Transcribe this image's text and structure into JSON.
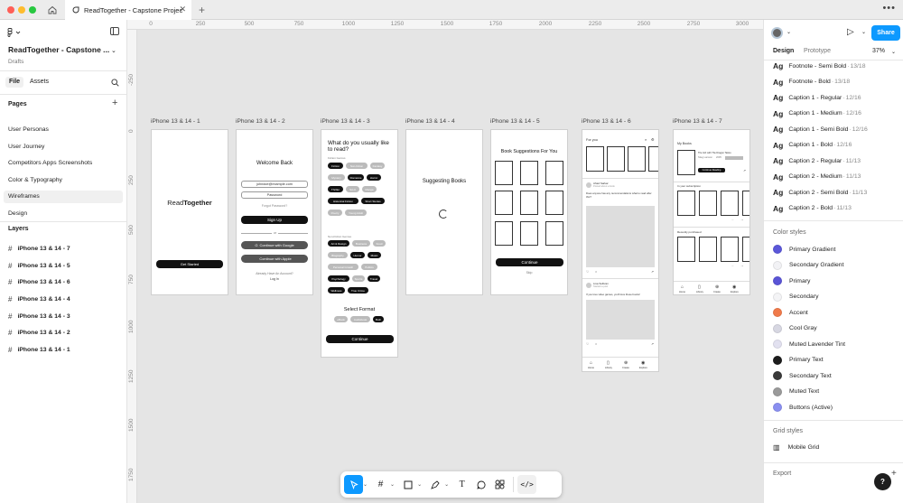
{
  "window": {
    "tab_title": "ReadTogether - Capstone Project",
    "tab_title_visible": "ReadTogether - Capstone Projec"
  },
  "left_panel": {
    "project_name": "ReadTogether - Capstone ...",
    "location": "Drafts",
    "tabs": [
      {
        "label": "File"
      },
      {
        "label": "Assets"
      }
    ],
    "pages_heading": "Pages",
    "pages": [
      {
        "label": "User Personas"
      },
      {
        "label": "User Journey"
      },
      {
        "label": "Competitors Apps Screenshots"
      },
      {
        "label": "Color & Typography"
      },
      {
        "label": "Wireframes"
      },
      {
        "label": "Design"
      }
    ],
    "selected_page": "Wireframes",
    "layers_heading": "Layers",
    "layers": [
      {
        "label": "iPhone 13 & 14 - 7"
      },
      {
        "label": "iPhone 13 & 14 - 5"
      },
      {
        "label": "iPhone 13 & 14 - 6"
      },
      {
        "label": "iPhone 13 & 14 - 4"
      },
      {
        "label": "iPhone 13 & 14 - 3"
      },
      {
        "label": "iPhone 13 & 14 - 2"
      },
      {
        "label": "iPhone 13 & 14 - 1"
      }
    ]
  },
  "rulers": {
    "top": [
      "0",
      "250",
      "500",
      "750",
      "1000",
      "1250",
      "1500",
      "1750",
      "2000",
      "2250",
      "2500",
      "2750",
      "3000"
    ],
    "left": [
      "-250",
      "0",
      "250",
      "500",
      "750",
      "1000",
      "1250",
      "1500",
      "1750"
    ]
  },
  "canvas": {
    "frame_labels": [
      "iPhone 13 & 14 - 1",
      "iPhone 13 & 14 - 2",
      "iPhone 13 & 14 - 3",
      "iPhone 13 & 14 - 4",
      "iPhone 13 & 14 - 5",
      "iPhone 13 & 14 - 6",
      "iPhone 13 & 14 - 7"
    ],
    "f1": {
      "brand_read": "Read",
      "brand_together": "Together",
      "button": "Get Started"
    },
    "f2": {
      "title": "Welcome Back",
      "email": "johndoe@example.com",
      "password": "Password",
      "forgot": "Forgot Password?",
      "signup": "Sign Up",
      "or": "or",
      "google": "Continue with Google",
      "apple": "Continue with Apple",
      "no_account": "Already Have An Account?",
      "login": "Log In"
    },
    "f3": {
      "title": "What do you usually like to read?",
      "fiction_label": "Fiction Genres",
      "fiction": [
        {
          "label": "Fiction",
          "sel": true
        },
        {
          "label": "Non-fiction",
          "sel": false
        },
        {
          "label": "Fantasy",
          "sel": false
        },
        {
          "label": "Mystery",
          "sel": false
        },
        {
          "label": "Romance",
          "sel": true
        },
        {
          "label": "Horror",
          "sel": true
        },
        {
          "label": "Thriller",
          "sel": true
        },
        {
          "label": "Sci-fi",
          "sel": false
        },
        {
          "label": "Manga",
          "sel": false
        },
        {
          "label": "Historical Fiction",
          "sel": true
        },
        {
          "label": "Short Stories",
          "sel": true
        },
        {
          "label": "Poetry",
          "sel": false
        },
        {
          "label": "Young Adult",
          "sel": false
        }
      ],
      "nonfiction_label": "Non-Fiction Genres",
      "nonfiction": [
        {
          "label": "Art & Design",
          "sel": true
        },
        {
          "label": "Business",
          "sel": false
        },
        {
          "label": "Food",
          "sel": false
        },
        {
          "label": "Biography",
          "sel": false
        },
        {
          "label": "Humor",
          "sel": true
        },
        {
          "label": "Music",
          "sel": true
        },
        {
          "label": "Personal Growth",
          "sel": false
        },
        {
          "label": "Politics",
          "sel": false
        },
        {
          "label": "Psychology",
          "sel": true
        },
        {
          "label": "Sports",
          "sel": false
        },
        {
          "label": "Travel",
          "sel": true
        },
        {
          "label": "Wellness",
          "sel": true
        },
        {
          "label": "True Crime",
          "sel": true
        }
      ],
      "format_title": "Select Format",
      "formats": [
        {
          "label": "eBook",
          "sel": false
        },
        {
          "label": "Audiobook",
          "sel": false
        },
        {
          "label": "Both",
          "sel": true
        }
      ],
      "continue": "Continue"
    },
    "f4": {
      "title": "Suggesting Books"
    },
    "f5": {
      "title": "Book Suggestions For You",
      "continue": "Continue",
      "skip": "Skip"
    },
    "f6": {
      "title": "For you",
      "user1": "Ahad Sarkar",
      "user1_sub": "Posted about a book",
      "post1": "Does anyone has any recommendations what to read after this?",
      "user2": "Lisa Sullivan",
      "user2_sub": "Started a post",
      "post2": "If you love video games, you'll love these books!",
      "nav": [
        "Home",
        "Library",
        "Create",
        "Explore"
      ]
    },
    "f7": {
      "my_books": "My Books",
      "book_title": "The Girl with The Dragon Tattoo",
      "book_author": "Stieg Larsson",
      "book_meta": "2005",
      "continue_reading": "Continue Reading",
      "subscription": "In your subscription",
      "purchased": "Recently purchased",
      "nav": [
        "Home",
        "Library",
        "Create",
        "Explore"
      ]
    }
  },
  "toolbar": {
    "tools": [
      "move-tool",
      "frame-tool",
      "shape-tool",
      "pen-tool",
      "text-tool",
      "comment-tool",
      "actions-tool",
      "dev-mode"
    ]
  },
  "right_panel": {
    "share": "Share",
    "tabs": [
      {
        "label": "Design"
      },
      {
        "label": "Prototype"
      }
    ],
    "zoom": "37%",
    "text_styles": [
      {
        "name": "Footnote - Semi Bold",
        "meta": "13/18"
      },
      {
        "name": "Footnote - Bold",
        "meta": "13/18"
      },
      {
        "name": "Caption 1 - Regular",
        "meta": "12/16"
      },
      {
        "name": "Caption 1 - Medium",
        "meta": "12/16"
      },
      {
        "name": "Caption 1 - Semi Bold",
        "meta": "12/16"
      },
      {
        "name": "Caption 1 - Bold",
        "meta": "12/16"
      },
      {
        "name": "Caption 2 - Regular",
        "meta": "11/13"
      },
      {
        "name": "Caption 2 - Medium",
        "meta": "11/13"
      },
      {
        "name": "Caption 2 - Semi Bold",
        "meta": "11/13"
      },
      {
        "name": "Caption 2 - Bold",
        "meta": "11/13"
      }
    ],
    "ag": "Ag",
    "color_styles_heading": "Color styles",
    "color_styles": [
      {
        "name": "Primary Gradient",
        "color": "#5b57d9"
      },
      {
        "name": "Secondary Gradient",
        "color": "#f2f2f5"
      },
      {
        "name": "Primary",
        "color": "#5a54d6"
      },
      {
        "name": "Secondary",
        "color": "#f4f4f6"
      },
      {
        "name": "Accent",
        "color": "#f07a4a"
      },
      {
        "name": "Cool Gray",
        "color": "#d7d7e2"
      },
      {
        "name": "Muted Lavender Tint",
        "color": "#e2e1f0"
      },
      {
        "name": "Primary Text",
        "color": "#1c1c1c"
      },
      {
        "name": "Secondary Text",
        "color": "#3a3a3a"
      },
      {
        "name": "Muted Text",
        "color": "#9a9a9a"
      },
      {
        "name": "Buttons (Active)",
        "color": "#8a8ff0"
      }
    ],
    "grid_styles_heading": "Grid styles",
    "grid_styles": [
      {
        "name": "Mobile Grid"
      }
    ],
    "export_heading": "Export",
    "help": "?"
  },
  "colors": {
    "accent": "#0d99ff",
    "canvas": "#e5e5e5"
  }
}
